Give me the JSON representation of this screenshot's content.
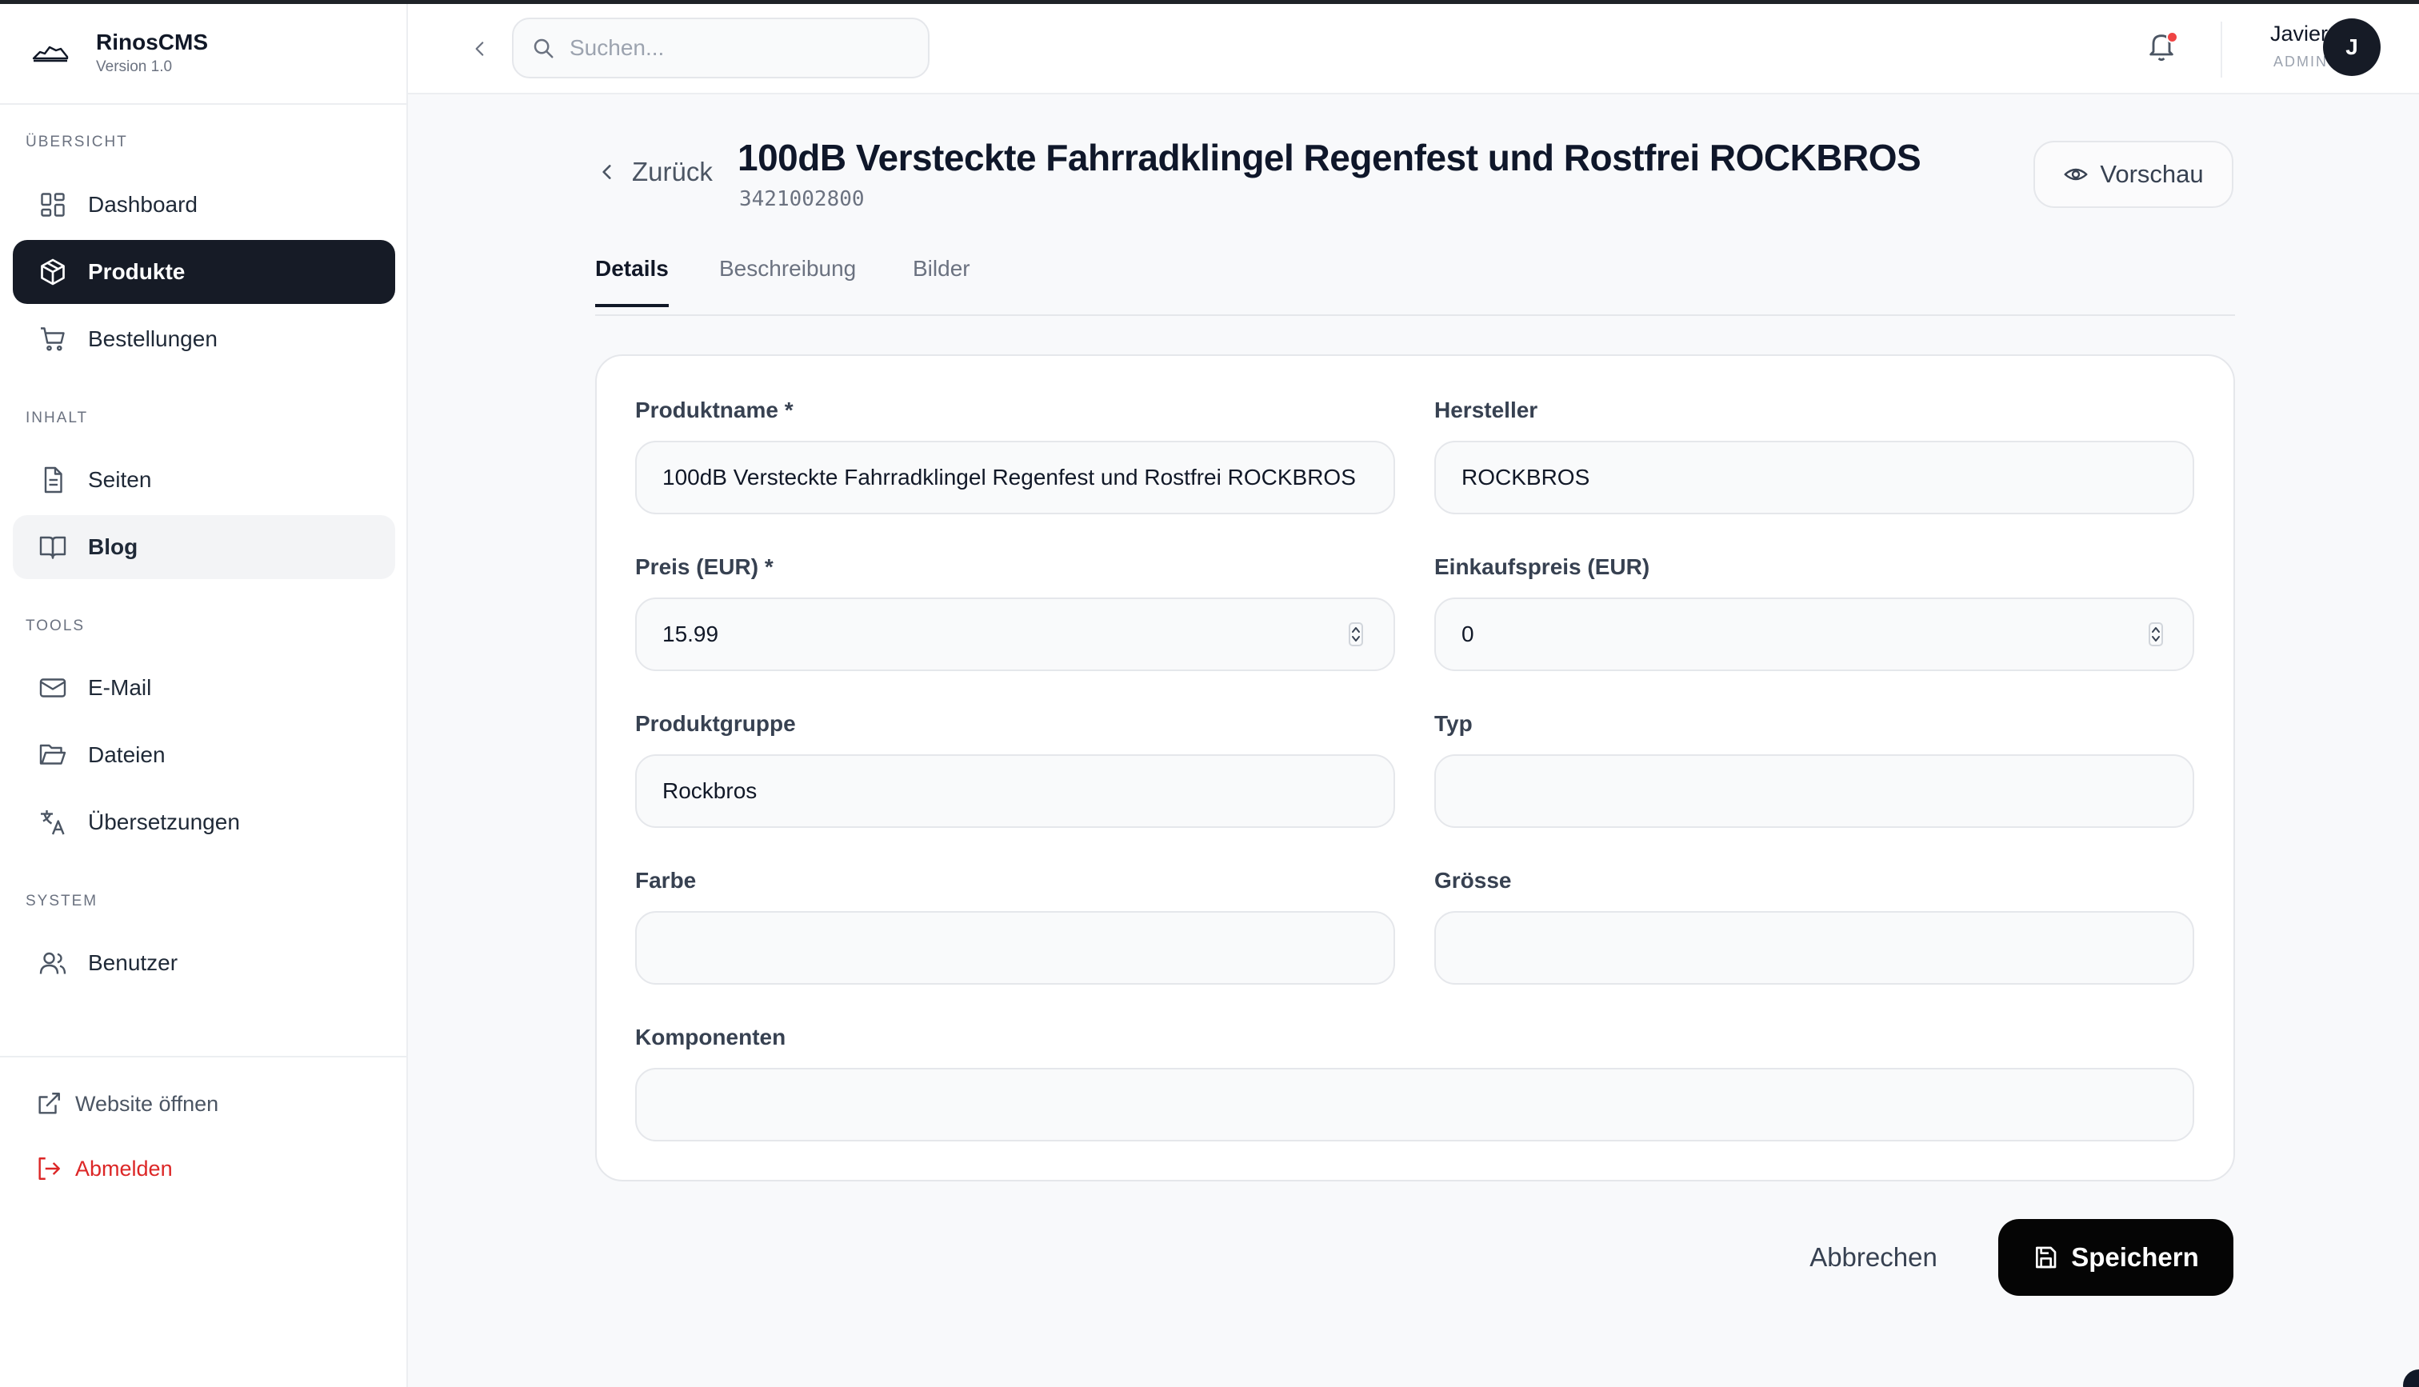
{
  "brand": {
    "name": "RinosCMS",
    "version": "Version 1.0"
  },
  "sidebar": {
    "sections": [
      {
        "label": "Übersicht"
      },
      {
        "label": "Inhalt"
      },
      {
        "label": "Tools"
      },
      {
        "label": "System"
      }
    ],
    "items": [
      {
        "label": "Dashboard",
        "icon": "dashboard-icon"
      },
      {
        "label": "Produkte",
        "icon": "package-icon",
        "state": "active"
      },
      {
        "label": "Bestellungen",
        "icon": "cart-icon"
      },
      {
        "label": "Seiten",
        "icon": "file-icon"
      },
      {
        "label": "Blog",
        "icon": "book-icon",
        "state": "hover"
      },
      {
        "label": "E-Mail",
        "icon": "mail-icon"
      },
      {
        "label": "Dateien",
        "icon": "folder-icon"
      },
      {
        "label": "Übersetzungen",
        "icon": "translate-icon"
      },
      {
        "label": "Benutzer",
        "icon": "users-icon"
      }
    ],
    "footer": {
      "open_website": "Website öffnen",
      "logout": "Abmelden"
    }
  },
  "header": {
    "search_placeholder": "Suchen...",
    "user": {
      "name": "Javier",
      "role": "ADMIN",
      "initial": "J"
    },
    "notification_color": "#ef4444"
  },
  "page": {
    "back_label": "Zurück",
    "title": "100dB Versteckte Fahrradklingel Regenfest und Rostfrei ROCKBROS",
    "sku": "3421002800",
    "preview_label": "Vorschau"
  },
  "tabs": [
    {
      "label": "Details",
      "active": true
    },
    {
      "label": "Beschreibung",
      "active": false
    },
    {
      "label": "Bilder",
      "active": false
    }
  ],
  "form": {
    "product_name": {
      "label": "Produktname *",
      "value": "100dB Versteckte Fahrradklingel Regenfest und Rostfrei ROCKBROS"
    },
    "manufacturer": {
      "label": "Hersteller",
      "value": "ROCKBROS"
    },
    "price": {
      "label": "Preis (EUR) *",
      "value": "15.99"
    },
    "purchase_price": {
      "label": "Einkaufspreis (EUR)",
      "value": "0"
    },
    "product_group": {
      "label": "Produktgruppe",
      "value": "Rockbros"
    },
    "type": {
      "label": "Typ",
      "value": ""
    },
    "color": {
      "label": "Farbe",
      "value": ""
    },
    "size": {
      "label": "Grösse",
      "value": ""
    },
    "components": {
      "label": "Komponenten",
      "value": ""
    }
  },
  "actions": {
    "cancel_label": "Abbrechen",
    "save_label": "Speichern"
  },
  "colors": {
    "primary_dark": "#161b26",
    "danger": "#dc2626",
    "accent_black": "#050505"
  }
}
